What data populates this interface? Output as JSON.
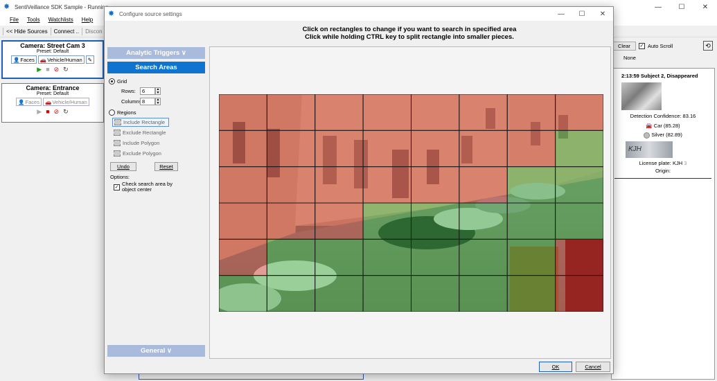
{
  "main_window": {
    "title": "SentiVeillance SDK Sample - Running",
    "menu": [
      "File",
      "Tools",
      "Watchlists",
      "Help"
    ],
    "toolbar": {
      "hide_sources": "<< Hide Sources",
      "connect": "Connect ..",
      "disconnect": "Discon"
    }
  },
  "cameras": [
    {
      "name": "Camera: Street Cam 3",
      "preset": "Preset: Default",
      "btn_faces": "Faces",
      "btn_vehicle": "Vehicle/Human",
      "active": true
    },
    {
      "name": "Camera: Entrance",
      "preset": "Preset: Default",
      "btn_faces": "Faces",
      "btn_vehicle": "Vehicle/Human",
      "active": false
    }
  ],
  "right_pane": {
    "clear_label": "Clear",
    "auto_scroll_label": "Auto Scroll",
    "auto_scroll_checked": true,
    "none_label": "None",
    "event": {
      "title": "2:13:59 Subject 2, Disappeared",
      "confidence": "Detection Confidence: 83.16",
      "car": "Car (85.28)",
      "silver": "Silver (82.89)",
      "plate_text": "KJH",
      "license_plate": "License plate: KJH",
      "plate_suffix": "3",
      "origin": "Origin:"
    }
  },
  "dialog": {
    "title": "Configure source settings",
    "instruction_1": "Click on rectangles to change if you want to search in specified area",
    "instruction_2": "Click while holding CTRL key to split rectangle into smaller pieces.",
    "sections": {
      "analytic_triggers": "Analytic Triggers ∨",
      "search_areas": "Search Areas",
      "general": "General ∨"
    },
    "grid_label": "Grid",
    "rows_label": "Rows:",
    "rows_value": "6",
    "columns_label": "Columns:",
    "columns_value": "8",
    "regions_label": "Regions",
    "region_tools": [
      "Include Rectangle",
      "Exclude Rectangle",
      "Include Polygon",
      "Exclude Polygon"
    ],
    "undo_label": "Undo",
    "reset_label": "Reset",
    "options_label": "Options:",
    "check_center_label": "Check search area by object center",
    "check_center_checked": true,
    "ok_label": "OK",
    "cancel_label": "Cancel"
  },
  "grid": {
    "rows": 6,
    "cols": 8,
    "include_color": "#3fb23c",
    "exclude_color": "#e0403a",
    "cells": [
      [
        0,
        0,
        0,
        0,
        0,
        0,
        0,
        0
      ],
      [
        0,
        0,
        0,
        0,
        0,
        0,
        0,
        1
      ],
      [
        0,
        0,
        0,
        0,
        0,
        0,
        1,
        1
      ],
      [
        0,
        0,
        0,
        1,
        1,
        1,
        1,
        1
      ],
      [
        0,
        1,
        1,
        1,
        1,
        1,
        1,
        0
      ],
      [
        1,
        1,
        1,
        1,
        1,
        1,
        1,
        0
      ]
    ]
  }
}
